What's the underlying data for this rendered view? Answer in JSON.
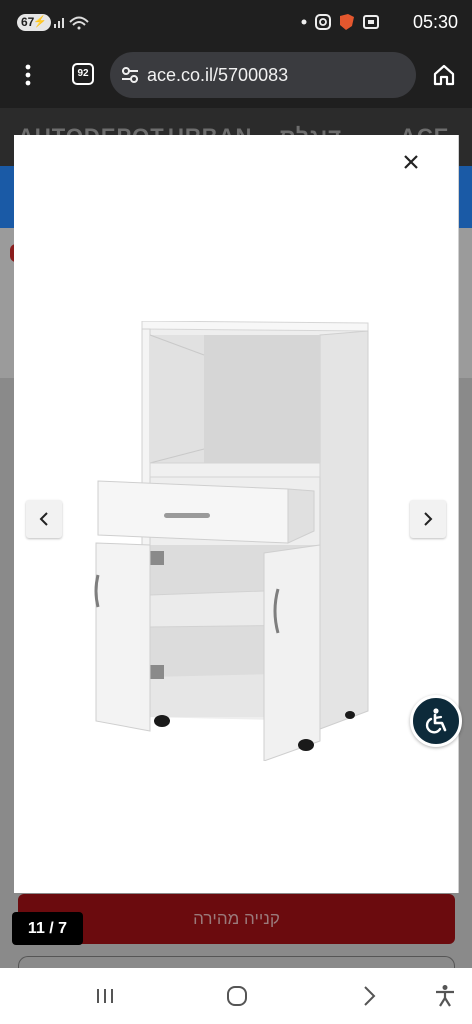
{
  "status_bar": {
    "battery_level": "67",
    "time": "05:30",
    "icons": [
      "battery-charging-icon",
      "signal-icon",
      "wifi-icon",
      "dot-icon",
      "instagram-icon",
      "shield-icon",
      "screenshot-icon"
    ]
  },
  "browser": {
    "url": "ace.co.il/5700083",
    "tab_count": "92"
  },
  "site": {
    "brands": [
      "AUTODEPOT",
      "URBAN",
      "דוגלס",
      "ACE"
    ]
  },
  "gallery": {
    "counter": "11 / 7",
    "buy_now_label": "קנייה מהירה",
    "image_alt": "white kitchen cabinet with open drawer and doors"
  },
  "colors": {
    "buy_button": "#6b0b0e",
    "accessibility_button": "#0d2a3a",
    "site_band": "#1a5aa6"
  }
}
